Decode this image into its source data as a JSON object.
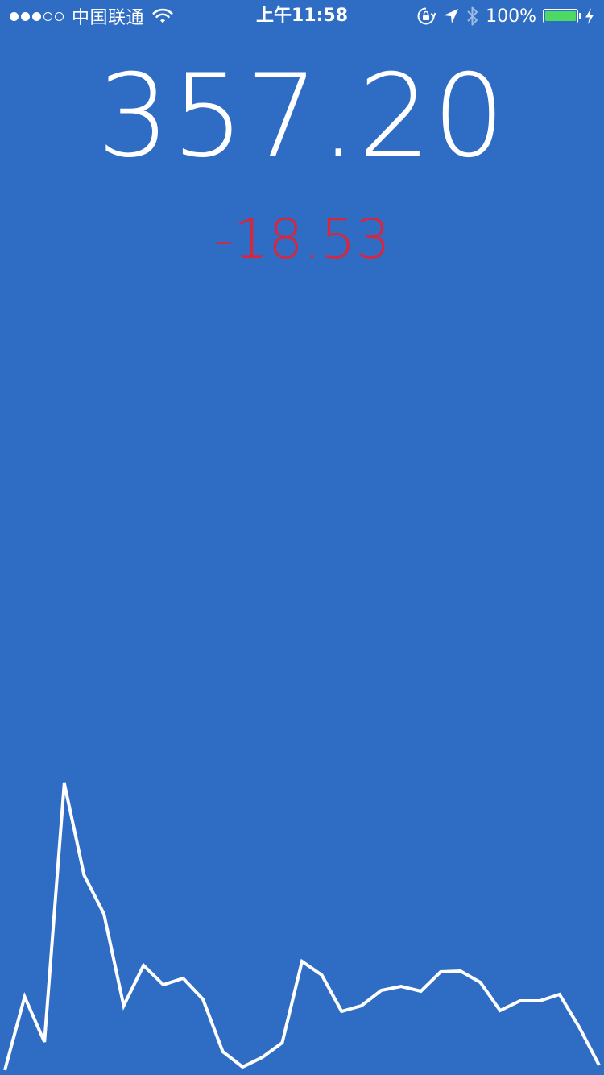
{
  "status_bar": {
    "signal_dots_filled": 3,
    "signal_dots_total": 5,
    "carrier": "中国联通",
    "time": "上午11:58",
    "battery_percent": "100%",
    "battery_color": "#4cd964",
    "icons": [
      "wifi-icon",
      "orientation-lock-icon",
      "location-arrow-icon",
      "bluetooth-icon",
      "battery-icon",
      "charging-bolt-icon"
    ]
  },
  "quote": {
    "price": "357.20",
    "change": "-18.53",
    "change_color": "#d7263d"
  },
  "theme": {
    "background": "#2f6dc4",
    "line_color": "#ffffff"
  },
  "chart_data": {
    "type": "line",
    "title": "",
    "xlabel": "",
    "ylabel": "",
    "grid": false,
    "legend": "none",
    "x": [
      0,
      1,
      2,
      3,
      4,
      5,
      6,
      7,
      8,
      9,
      10,
      11,
      12,
      13,
      14,
      15,
      16,
      17,
      18,
      19,
      20,
      21,
      22,
      23,
      24,
      25,
      26,
      27,
      28,
      29,
      30
    ],
    "values": [
      0,
      91,
      35,
      356,
      242,
      194,
      80,
      130,
      106,
      114,
      88,
      23,
      4,
      16,
      34,
      135,
      118,
      73,
      80,
      99,
      104,
      98,
      122,
      123,
      109,
      74,
      86,
      86,
      94,
      53,
      6
    ],
    "ylim": [
      0,
      360
    ]
  }
}
